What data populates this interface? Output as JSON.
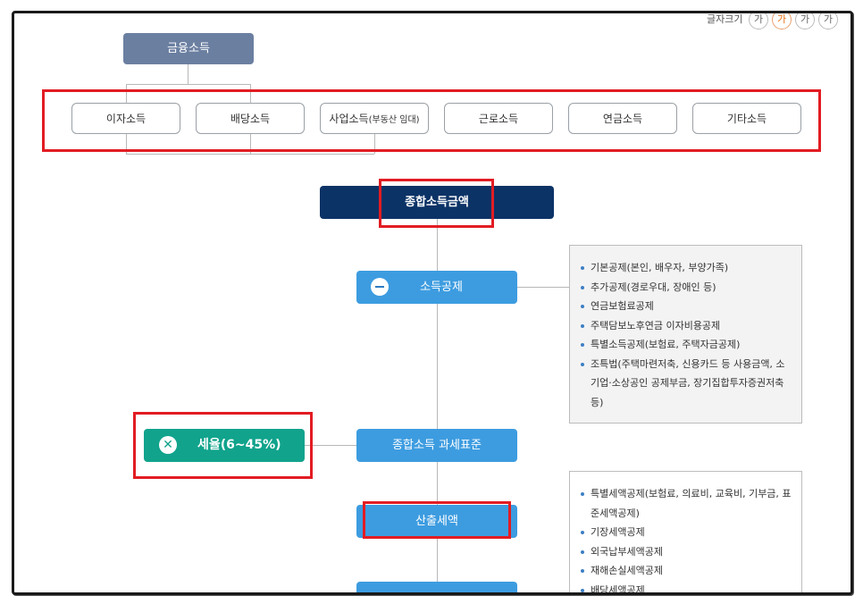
{
  "font_size_control": {
    "label": "글자크기",
    "buttons": [
      "가",
      "가",
      "가",
      "가"
    ],
    "active_index": 1
  },
  "hierarchy": {
    "root": "금융소득",
    "categories": [
      "이자소득",
      "배당소득",
      "사업소득",
      "근로소득",
      "연금소득",
      "기타소득"
    ],
    "business_sub": "(부동산 임대)"
  },
  "flow": {
    "total_income": "종합소득금액",
    "deduction": "소득공제",
    "tax_base": "종합소득 과세표준",
    "tax_rate": "세율(6~45%)",
    "calculated_tax": "산출세액"
  },
  "deduction_list": [
    "기본공제(본인, 배우자, 부양가족)",
    "추가공제(경로우대, 장애인 등)",
    "연금보험료공제",
    "주택담보노후연금 이자비용공제",
    "특별소득공제(보험료, 주택자금공제)",
    "조특법(주택마련저축, 신용카드 등 사용금액, 소기업·소상공인 공제부금, 장기집합투자증권저축 등)"
  ],
  "tax_credit_list": [
    "특별세액공제(보험료, 의료비, 교육비, 기부금, 표준세액공제)",
    "기장세액공제",
    "외국납부세액공제",
    "재해손실세액공제",
    "배당세액공제"
  ],
  "colors": {
    "red_highlight": "#e21c23",
    "navy": "#0c3366",
    "blue": "#3d9ce0",
    "green": "#11a38c",
    "slate": "#6b7fa1"
  }
}
